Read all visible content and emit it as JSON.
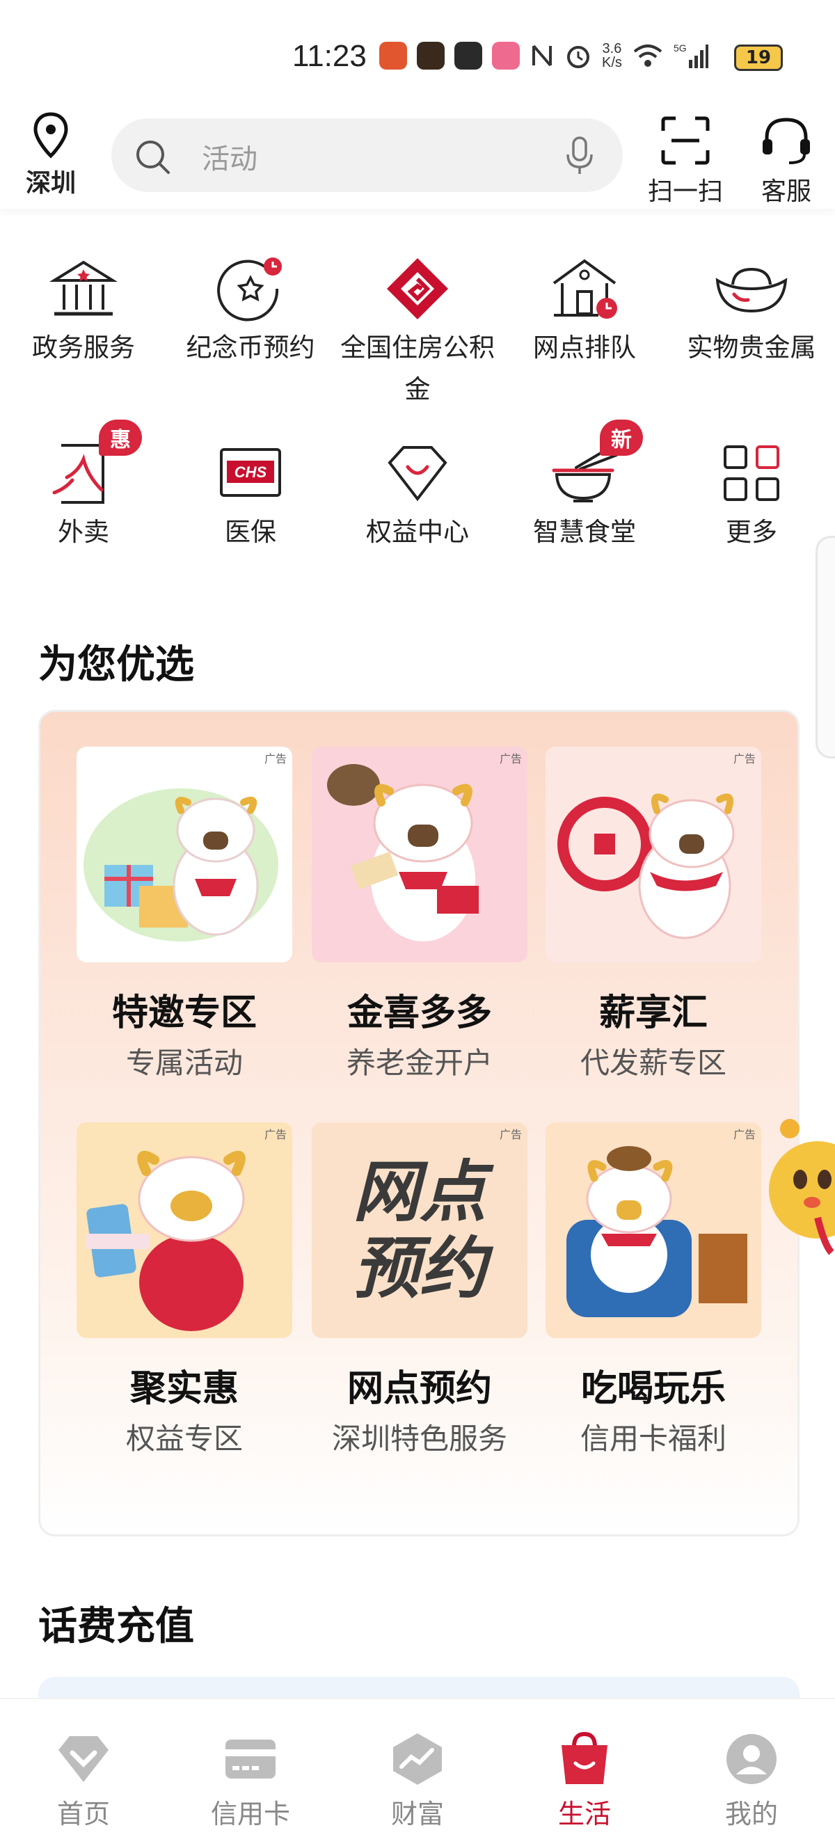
{
  "status_bar": {
    "time": "11:23",
    "net_speed_top": "3.6",
    "net_speed_bottom": "K/s",
    "battery": "19"
  },
  "header": {
    "location": "深圳",
    "search_placeholder": "活动",
    "scan_label": "扫一扫",
    "service_label": "客服"
  },
  "quick_services": [
    {
      "label": "政务服务",
      "icon": "government-building-icon"
    },
    {
      "label": "纪念币预约",
      "icon": "coin-star-clock-icon"
    },
    {
      "label": "全国住房公积金",
      "icon": "housing-fund-logo-icon"
    },
    {
      "label": "网点排队",
      "icon": "bank-queue-icon"
    },
    {
      "label": "实物贵金属",
      "icon": "gold-ingot-icon"
    },
    {
      "label": "外卖",
      "icon": "takeout-icon",
      "badge": "惠"
    },
    {
      "label": "医保",
      "icon": "chs-medical-insurance-icon"
    },
    {
      "label": "权益中心",
      "icon": "diamond-smile-icon"
    },
    {
      "label": "智慧食堂",
      "icon": "bowl-chopsticks-icon",
      "badge": "新"
    },
    {
      "label": "更多",
      "icon": "grid-more-icon"
    }
  ],
  "featured": {
    "title": "为您优选",
    "ad_label": "广告",
    "tiles": [
      {
        "name": "特邀专区",
        "sub": "专属活动"
      },
      {
        "name": "金喜多多",
        "sub": "养老金开户"
      },
      {
        "name": "薪享汇",
        "sub": "代发薪专区"
      },
      {
        "name": "聚实惠",
        "sub": "权益专区"
      },
      {
        "name": "网点预约",
        "sub": "深圳特色服务",
        "image_text_1": "网点",
        "image_text_2": "预约"
      },
      {
        "name": "吃喝玩乐",
        "sub": "信用卡福利"
      }
    ]
  },
  "topup": {
    "title": "话费充值"
  },
  "tabbar": {
    "items": [
      {
        "label": "首页",
        "icon": "home-diamond-icon"
      },
      {
        "label": "信用卡",
        "icon": "credit-card-icon"
      },
      {
        "label": "财富",
        "icon": "wealth-chart-icon"
      },
      {
        "label": "生活",
        "icon": "shopping-bag-icon",
        "active": true
      },
      {
        "label": "我的",
        "icon": "user-profile-icon"
      }
    ]
  },
  "colors": {
    "brand_red": "#c8102e",
    "badge_red": "#d7263d",
    "card_peach": "#fbd9c8"
  }
}
